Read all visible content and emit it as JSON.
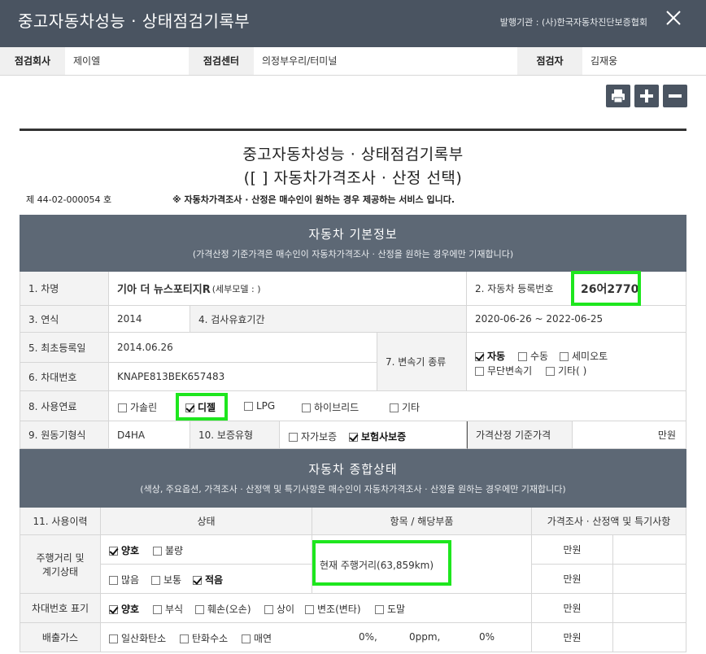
{
  "window": {
    "title": "중고자동차성능 · 상태점검기록부",
    "publisher": "발행기관 : (사)한국자동차진단보증협회"
  },
  "info": {
    "company_label": "점검회사",
    "company_value": "제이엘",
    "center_label": "점검센터",
    "center_value": "의정부우리/터미널",
    "inspector_label": "점검자",
    "inspector_value": "김재웅"
  },
  "toolbar": {
    "icons": [
      "printer-icon",
      "plus-icon",
      "minus-icon"
    ]
  },
  "document": {
    "title": "중고자동차성능 · 상태점검기록부",
    "subtitle": "([ ] 자동차가격조사 · 산정 선택)",
    "number": "제 44-02-000054 호",
    "notice": "※ 자동차가격조사 · 산정은 매수인이 원하는 경우 제공하는 서비스 입니다."
  },
  "basic": {
    "heading": "자동차 기본정보",
    "sub": "(가격산정 기준가격은 매수인이 자동차가격조사 · 산정을 원하는 경우에만 기재합니다)",
    "car_name_label": "1. 차명",
    "car_name_value": "기아 더 뉴스포티지R",
    "car_name_sub": "(세부모델 : )",
    "reg_no_label": "2. 자동차 등록번호",
    "reg_no_value": "26어2770",
    "year_label": "3. 연식",
    "year_value": "2014",
    "inspect_period_label": "4. 검사유효기간",
    "inspect_period_value": "2020-06-26 ~ 2022-06-25",
    "first_reg_label": "5. 최초등록일",
    "first_reg_value": "2014.06.26",
    "vin_label": "6. 차대번호",
    "vin_value": "KNAPE813BEK657483",
    "trans_label": "7. 변속기 종류",
    "trans_options": [
      {
        "label": "자동",
        "checked": true
      },
      {
        "label": "수동",
        "checked": false
      },
      {
        "label": "세미오토",
        "checked": false
      },
      {
        "label": "무단변속기",
        "checked": false
      },
      {
        "label": "기타( )",
        "checked": false
      }
    ],
    "fuel_label": "8. 사용연료",
    "fuel_options": [
      {
        "label": "가솔린",
        "checked": false
      },
      {
        "label": "디젤",
        "checked": true
      },
      {
        "label": "LPG",
        "checked": false
      },
      {
        "label": "하이브리드",
        "checked": false
      },
      {
        "label": "기타",
        "checked": false
      }
    ],
    "engine_label": "9. 원동기형식",
    "engine_value": "D4HA",
    "warranty_label": "10. 보증유형",
    "warranty_options": [
      {
        "label": "자가보증",
        "checked": false
      },
      {
        "label": "보험사보증",
        "checked": true
      }
    ],
    "price_base_label": "가격산정 기준가격",
    "price_base_unit": "만원"
  },
  "overall": {
    "heading": "자동차 종합상태",
    "sub": "(색상, 주요옵션, 가격조사 · 산정액 및 특기사항은 매수인이 자동차가격조사 · 산정을 원하는 경우에만 기재합니다)",
    "col_usage": "11. 사용이력",
    "col_state": "상태",
    "col_item": "항목 / 해당부품",
    "col_price": "가격조사 · 산정액 및 특기사항",
    "mileage_label": "주행거리 및 계기상태",
    "mileage_row1": [
      {
        "label": "양호",
        "checked": true
      },
      {
        "label": "불량",
        "checked": false
      }
    ],
    "mileage_row2": [
      {
        "label": "많음",
        "checked": false
      },
      {
        "label": "보통",
        "checked": false
      },
      {
        "label": "적음",
        "checked": true
      }
    ],
    "mileage_item": "현재 주행거리(63,859km)",
    "unit": "만원",
    "vin_mark_label": "차대번호 표기",
    "vin_mark_options": [
      {
        "label": "양호",
        "checked": true
      },
      {
        "label": "부식",
        "checked": false
      },
      {
        "label": "훼손(오손)",
        "checked": false
      },
      {
        "label": "상이",
        "checked": false
      },
      {
        "label": "변조(변타)",
        "checked": false
      },
      {
        "label": "도말",
        "checked": false
      }
    ],
    "emission_label": "배출가스",
    "emission_options": [
      {
        "label": "일산화탄소",
        "checked": false
      },
      {
        "label": "탄화수소",
        "checked": false
      },
      {
        "label": "매연",
        "checked": false
      }
    ],
    "emission_values": [
      "0%,",
      "0ppm,",
      "0%"
    ]
  }
}
